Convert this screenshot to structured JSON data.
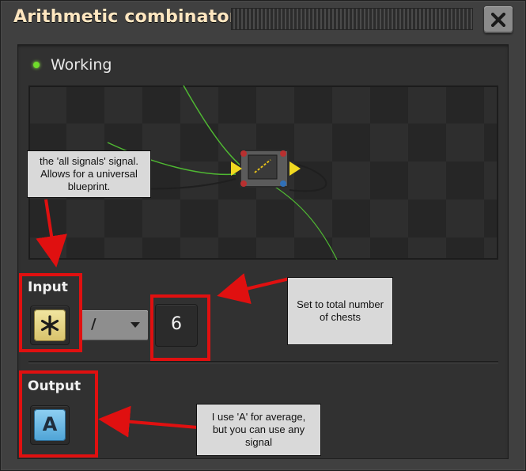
{
  "window": {
    "title": "Arithmetic combinator",
    "close_icon": "close-icon"
  },
  "status": {
    "text": "Working",
    "indicator_color": "#6fdc2a"
  },
  "input": {
    "label": "Input",
    "signal_icon": "each-signal-asterisk-icon",
    "operator": "/",
    "constant": "6"
  },
  "output": {
    "label": "Output",
    "signal_letter": "A"
  },
  "annotations": {
    "signal_note": "the 'all signals' signal. Allows for a universal blueprint.",
    "constant_note": "Set to total number of chests",
    "output_note": "I use 'A' for average, but you can use any signal",
    "highlight_color": "#e01010"
  }
}
